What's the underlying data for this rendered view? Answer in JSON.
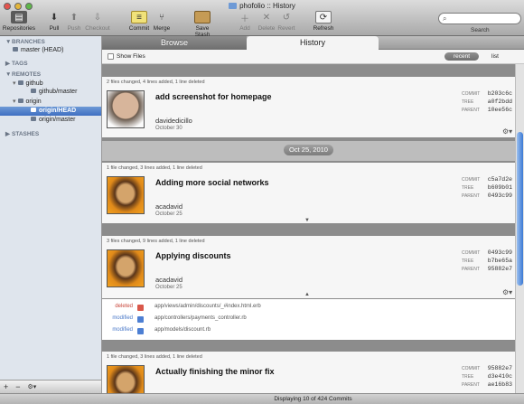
{
  "window": {
    "title": "phofolio :: History"
  },
  "toolbar": {
    "repositories": "Repositories",
    "pull": "Pull",
    "push": "Push",
    "checkout": "Checkout",
    "commit": "Commit",
    "merge": "Merge",
    "save_stash": "Save Stash",
    "add": "Add",
    "delete": "Delete",
    "revert": "Revert",
    "refresh": "Refresh",
    "search_label": "Search",
    "search_placeholder": ""
  },
  "sidebar": {
    "branches": "BRANCHES",
    "branch_master": "master (HEAD)",
    "tags": "TAGS",
    "remotes": "REMOTES",
    "github": "github",
    "github_master": "github/master",
    "origin": "origin",
    "origin_head": "origin/HEAD",
    "origin_master": "origin/master",
    "stashes": "STASHES",
    "bottom_add": "+",
    "bottom_remove": "−",
    "bottom_gear": "⚙▾"
  },
  "tabs": {
    "browse": "Browse",
    "history": "History"
  },
  "filter": {
    "show_files": "Show Files",
    "recent": "recent",
    "list": "list"
  },
  "labels": {
    "commit": "COMMIT",
    "tree": "TREE",
    "parent": "PARENT"
  },
  "commits": [
    {
      "stats": "2 files changed, 4 lines added, 1 line deleted",
      "message": "add screenshot for homepage",
      "author": "davidedicillo",
      "date": "October 30",
      "commit": "b203c6c",
      "tree": "a0f2bdd",
      "parent": "10ee56c"
    },
    {
      "stats": "1 file changed, 3 lines added, 1 line deleted",
      "message": "Adding more social networks",
      "author": "acadavid",
      "date": "October 25",
      "commit": "c5a7d2e",
      "tree": "b609b01",
      "parent": "0493c99"
    },
    {
      "stats": "3 files changed, 9 lines added, 1 line deleted",
      "message": "Applying discounts",
      "author": "acadavid",
      "date": "October 25",
      "commit": "0493c99",
      "tree": "b7be65a",
      "parent": "95882e7"
    },
    {
      "stats": "1 file changed, 3 lines added, 1 line deleted",
      "message": "Actually finishing the minor fix",
      "author": "",
      "date": "",
      "commit": "95882e7",
      "tree": "d3e410c",
      "parent": "ae16b83"
    }
  ],
  "date_separator": "Oct 25, 2010",
  "files": [
    {
      "status": "deleted",
      "path": "app/views/admin/discounts/_#index.html.erb"
    },
    {
      "status": "modified",
      "path": "app/controllers/payments_controller.rb"
    },
    {
      "status": "modified",
      "path": "app/models/discount.rb"
    }
  ],
  "status_bar": "Displaying 10 of 424 Commits",
  "colors": {
    "selection": "#3f6fc2",
    "deleted": "#c8453a",
    "modified": "#4a78c8"
  }
}
